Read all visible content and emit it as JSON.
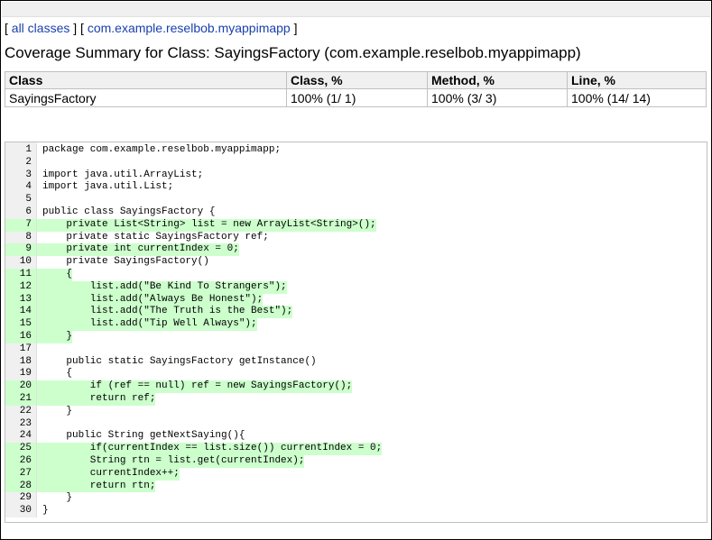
{
  "breadcrumb": {
    "open": "[ ",
    "link_all": "all classes",
    "mid": " ] [ ",
    "link_pkg": "com.example.reselbob.myappimapp",
    "close": " ]"
  },
  "title": "Coverage Summary for Class: SayingsFactory (com.example.reselbob.myappimapp)",
  "summary": {
    "headers": [
      "Class",
      "Class, %",
      "Method, %",
      "Line, %"
    ],
    "row": [
      "SayingsFactory",
      "100% (1/ 1)",
      "100% (3/ 3)",
      "100% (14/ 14)"
    ]
  },
  "colors": {
    "covered": "#ccffcc",
    "header_bg": "#f0f0f0",
    "link": "#1a3fae"
  },
  "code_lines": [
    {
      "n": "1",
      "text": "package com.example.reselbob.myappimapp;",
      "covered": false
    },
    {
      "n": "2",
      "text": "",
      "covered": false
    },
    {
      "n": "3",
      "text": "import java.util.ArrayList;",
      "covered": false
    },
    {
      "n": "4",
      "text": "import java.util.List;",
      "covered": false
    },
    {
      "n": "5",
      "text": "",
      "covered": false
    },
    {
      "n": "6",
      "text": "public class SayingsFactory {",
      "covered": false
    },
    {
      "n": "7",
      "text": "    private List<String> list = new ArrayList<String>();",
      "covered": true
    },
    {
      "n": "8",
      "text": "    private static SayingsFactory ref;",
      "covered": false
    },
    {
      "n": "9",
      "text": "    private int currentIndex = 0;",
      "covered": true
    },
    {
      "n": "10",
      "text": "    private SayingsFactory()",
      "covered": false
    },
    {
      "n": "11",
      "text": "    {",
      "covered": true
    },
    {
      "n": "12",
      "text": "        list.add(\"Be Kind To Strangers\");",
      "covered": true
    },
    {
      "n": "13",
      "text": "        list.add(\"Always Be Honest\");",
      "covered": true
    },
    {
      "n": "14",
      "text": "        list.add(\"The Truth is the Best\");",
      "covered": true
    },
    {
      "n": "15",
      "text": "        list.add(\"Tip Well Always\");",
      "covered": true
    },
    {
      "n": "16",
      "text": "    }",
      "covered": true
    },
    {
      "n": "17",
      "text": "",
      "covered": false
    },
    {
      "n": "18",
      "text": "    public static SayingsFactory getInstance()",
      "covered": false
    },
    {
      "n": "19",
      "text": "    {",
      "covered": false
    },
    {
      "n": "20",
      "text": "        if (ref == null) ref = new SayingsFactory();",
      "covered": true
    },
    {
      "n": "21",
      "text": "        return ref;",
      "covered": true
    },
    {
      "n": "22",
      "text": "    }",
      "covered": false
    },
    {
      "n": "23",
      "text": "",
      "covered": false
    },
    {
      "n": "24",
      "text": "    public String getNextSaying(){",
      "covered": false
    },
    {
      "n": "25",
      "text": "        if(currentIndex == list.size()) currentIndex = 0;",
      "covered": true
    },
    {
      "n": "26",
      "text": "        String rtn = list.get(currentIndex);",
      "covered": true
    },
    {
      "n": "27",
      "text": "        currentIndex++;",
      "covered": true
    },
    {
      "n": "28",
      "text": "        return rtn;",
      "covered": true
    },
    {
      "n": "29",
      "text": "    }",
      "covered": false
    },
    {
      "n": "30",
      "text": "}",
      "covered": false
    }
  ]
}
